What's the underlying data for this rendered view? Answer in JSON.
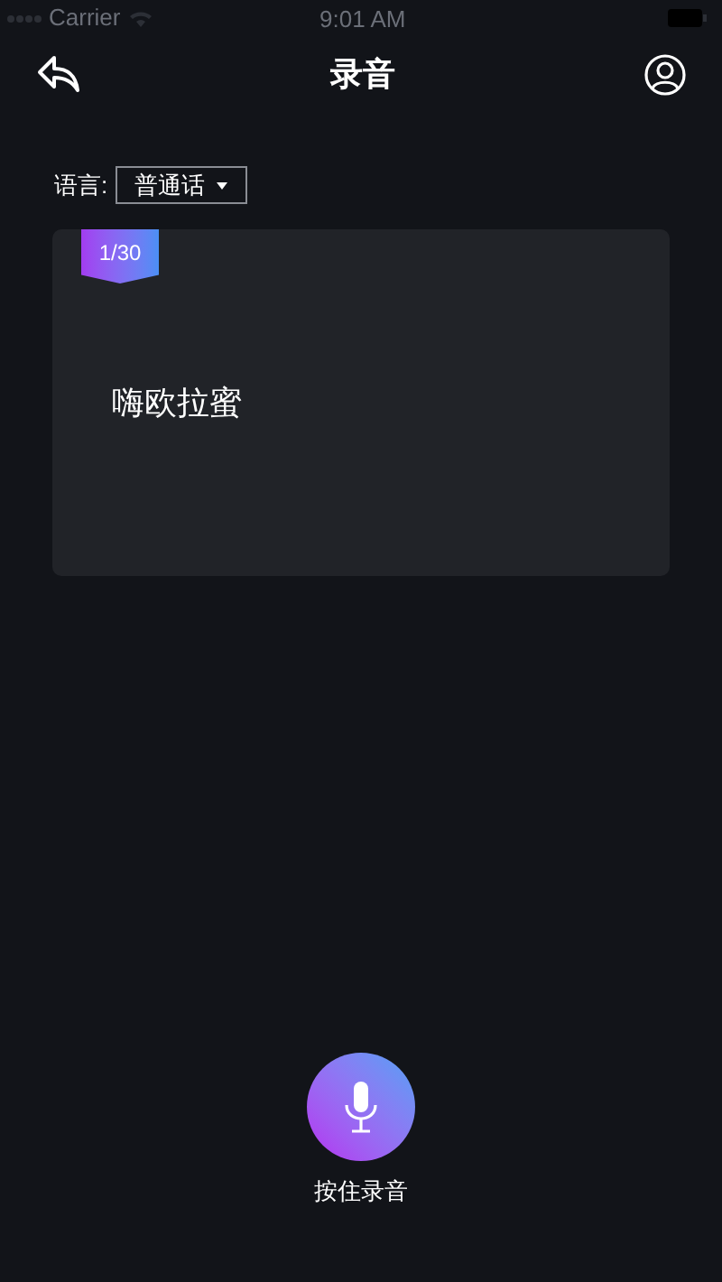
{
  "status_bar": {
    "carrier": "Carrier",
    "time": "9:01 AM"
  },
  "nav": {
    "title": "录音"
  },
  "language": {
    "label": "语言:",
    "value": "普通话"
  },
  "card": {
    "counter": "1/30",
    "phrase": "嗨欧拉蜜"
  },
  "record": {
    "label": "按住录音"
  }
}
